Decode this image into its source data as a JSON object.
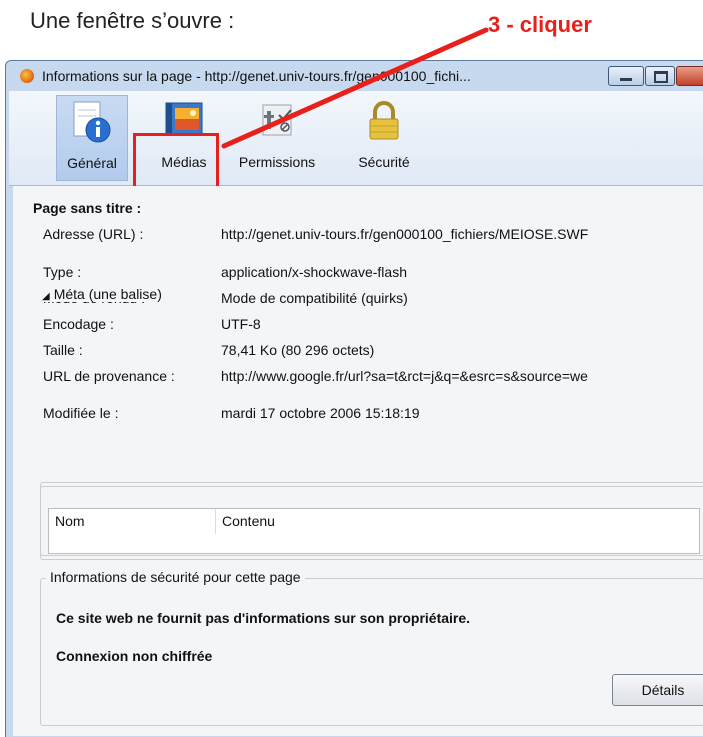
{
  "caption": "Une fenêtre s’ouvre :",
  "callout": "3 - cliquer",
  "window": {
    "title": "Informations sur la page - http://genet.univ-tours.fr/gen000100_fichi..."
  },
  "toolbar": {
    "general": "Général",
    "medias": "Médias",
    "permissions": "Permissions",
    "securite": "Sécurité"
  },
  "general": {
    "heading": "Page sans titre :",
    "fields": [
      {
        "label": "Adresse (URL) :",
        "value": "http://genet.univ-tours.fr/gen000100_fichiers/MEIOSE.SWF"
      },
      {
        "label": "Type :",
        "value": "application/x-shockwave-flash"
      },
      {
        "label": "Mode de rendu :",
        "value": "Mode de compatibilité (quirks)"
      },
      {
        "label": "Encodage :",
        "value": "UTF-8"
      },
      {
        "label": "Taille :",
        "value": "78,41 Ko (80 296 octets)"
      },
      {
        "label": "URL de provenance :",
        "value": "http://www.google.fr/url?sa=t&rct=j&q=&esrc=s&source=we"
      },
      {
        "label": "Modifiée le :",
        "value": "mardi 17 octobre 2006 15:18:19"
      }
    ],
    "meta": {
      "legend": "Méta (une balise)",
      "columns": [
        "Nom",
        "Contenu"
      ]
    },
    "security": {
      "legend": "Informations de sécurité pour cette page",
      "owner": "Ce site web ne fournit pas d'informations sur son propriétaire.",
      "connection": "Connexion non chiffrée",
      "details_button": "Détails"
    }
  },
  "colors": {
    "highlight": "#e8201c",
    "window_frame": "#c7d9ee"
  }
}
